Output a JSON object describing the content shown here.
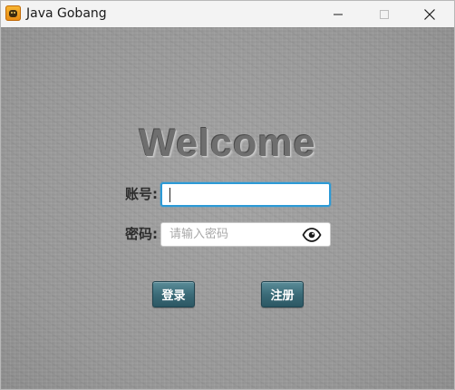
{
  "window": {
    "title": "Java Gobang",
    "app_icon": "gobang-app-icon",
    "controls": [
      "minimize-icon",
      "maximize-icon",
      "close-icon"
    ]
  },
  "login": {
    "welcome": "Welcome",
    "account_label": "账号:",
    "account_value": "",
    "password_label": "密码:",
    "password_placeholder": "请输入密码",
    "password_toggle_icon": "eye-icon",
    "login_button": "登录",
    "register_button": "注册"
  },
  "colors": {
    "background": "#9c9c9c",
    "focus_border": "#2c9ad6",
    "button": "#3b6b78"
  }
}
